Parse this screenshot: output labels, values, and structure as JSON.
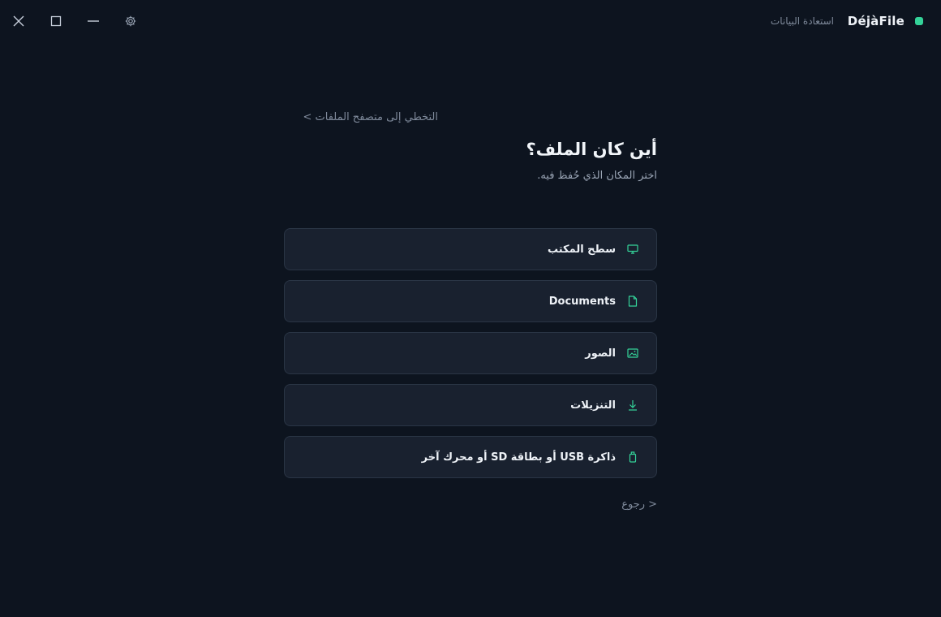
{
  "app": {
    "name": "DéjàFile",
    "subtitle": "استعادة البيانات",
    "accent_color": "#34d399",
    "status_icon": "status-dot-icon"
  },
  "window_controls": {
    "close_icon": "close-icon",
    "maximize_icon": "maximize-icon",
    "minimize_icon": "minimize-icon",
    "settings_icon": "gear-icon"
  },
  "main": {
    "skip_link": "التخطي إلى متصفح الملفات >",
    "title": "أين كان الملف؟",
    "subtitle": "اختر المكان الذي حُفظ فيه.",
    "locations": [
      {
        "label": "سطح المكتب",
        "icon": "monitor-icon"
      },
      {
        "label": "Documents",
        "icon": "document-icon"
      },
      {
        "label": "الصور",
        "icon": "image-icon"
      },
      {
        "label": "التنزيلات",
        "icon": "download-icon"
      },
      {
        "label": "ذاكرة USB أو بطاقة SD أو محرك آخر",
        "icon": "usb-drive-icon"
      }
    ],
    "back_link": "< رجوع"
  }
}
